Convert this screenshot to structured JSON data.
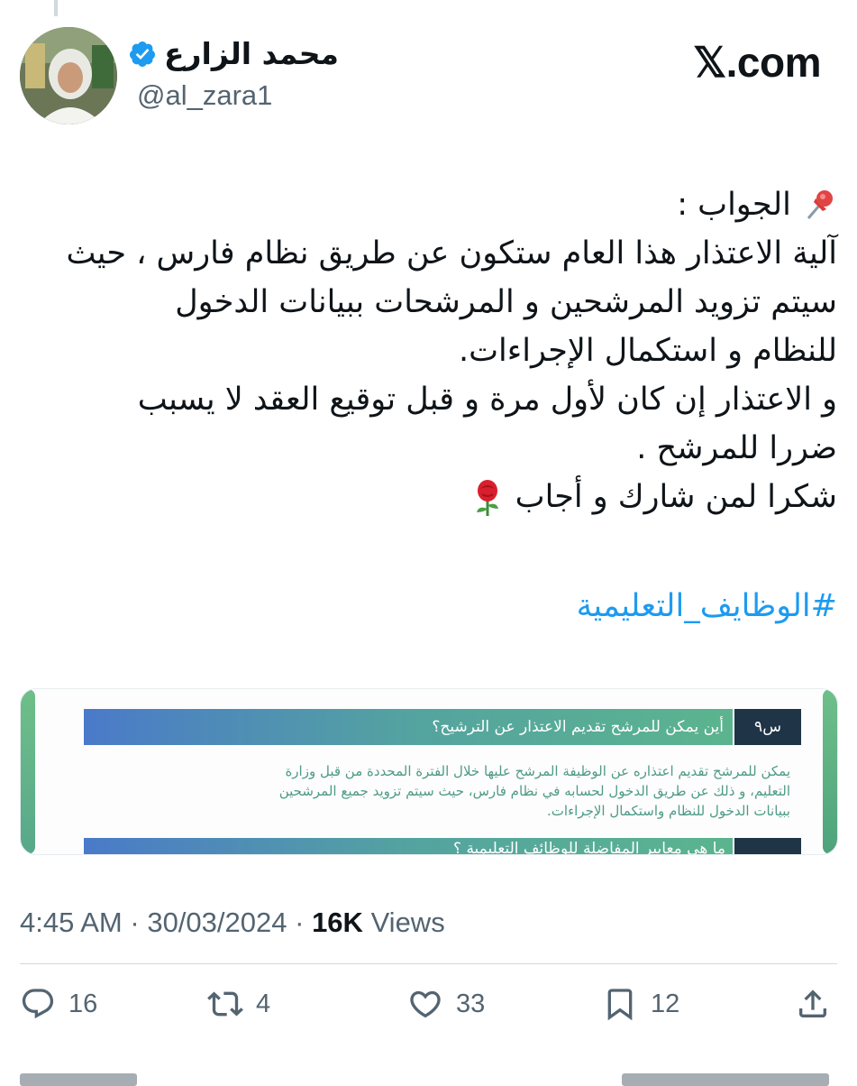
{
  "site": {
    "label": "𝕏.com"
  },
  "author": {
    "display_name": "محمد الزارع",
    "handle": "@al_zara1",
    "verified": true
  },
  "tweet": {
    "lines": [
      "الجواب :",
      "آلية الاعتذار هذا العام ستكون عن طريق نظام فارس ، حيث",
      "سيتم تزويد المرشحين و المرشحات  ببيانات الدخول",
      "للنظام و استكمال الإجراءات.",
      "و الاعتذار إن كان لأول مرة و قبل توقيع العقد لا يسبب",
      "ضررا للمرشح .",
      "شكرا لمن شارك و أجاب"
    ],
    "hashtag": "#الوظايف_التعليمية"
  },
  "media": {
    "question_badge": "س٩",
    "question": "أين يمكن للمرشح تقديم الاعتذار عن الترشيح؟",
    "answer_lines": [
      "يمكن للمرشح تقديم اعتذاره عن الوظيفة المرشح عليها خلال الفترة المحددة من قبل وزارة",
      "التعليم، و ذلك عن طريق الدخول لحسابه في نظام فارس، حيث سيتم تزويد جميع المرشحين",
      "ببيانات الدخول للنظام واستكمال الإجراءات."
    ],
    "next_question_partial": "ما هي معايير المفاضلة للوظائف التعليمية ؟"
  },
  "meta": {
    "time": "4:45 AM",
    "separator": "·",
    "date": "30/03/2024",
    "views_count": "16K",
    "views_label": "Views"
  },
  "actions": {
    "replies": "16",
    "reposts": "4",
    "likes": "33",
    "bookmarks": "12"
  },
  "colors": {
    "accent": "#1d9bf0",
    "secondary_text": "#536471",
    "primary_text": "#0f1419"
  }
}
